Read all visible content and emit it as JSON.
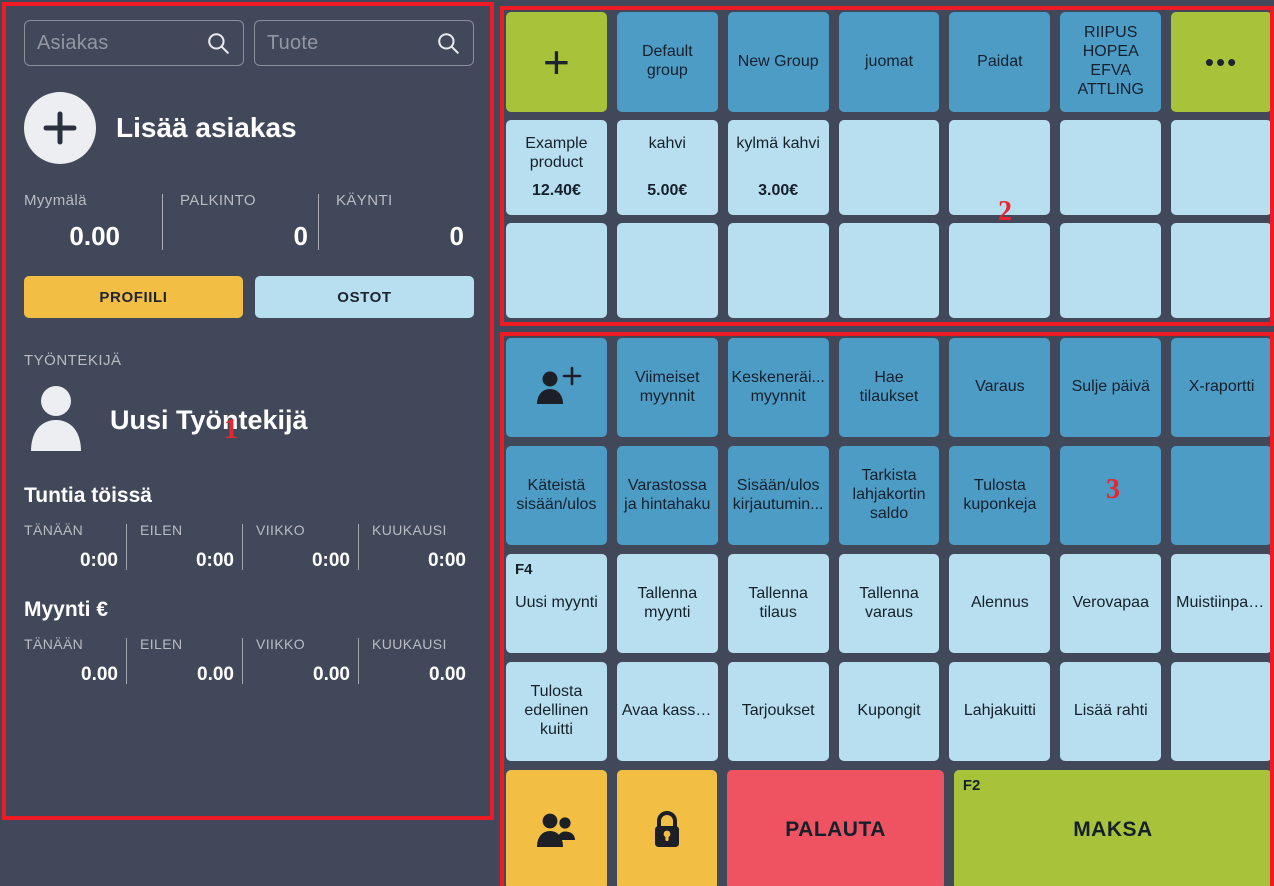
{
  "colors": {
    "background": "#414859",
    "green": "#a8c23a",
    "steel_blue": "#4c9cc6",
    "light_blue": "#b8dff0",
    "yellow": "#f2bf44",
    "red": "#ef5260",
    "annotation_red": "#ee1b24"
  },
  "annotations": [
    {
      "number": "1",
      "region": "customer-and-employee-panel"
    },
    {
      "number": "2",
      "region": "product-grid-panel"
    },
    {
      "number": "3",
      "region": "function-button-panel"
    }
  ],
  "left_panel": {
    "search": {
      "customer": {
        "placeholder": "Asiakas",
        "value": "",
        "icon": "search-icon"
      },
      "product": {
        "placeholder": "Tuote",
        "value": "",
        "icon": "search-icon"
      }
    },
    "customer": {
      "icon": "plus-circle-icon",
      "title": "Lisää asiakas",
      "stats": [
        {
          "label": "Myymälä",
          "value": "0.00"
        },
        {
          "label": "PALKINTO",
          "value": "0"
        },
        {
          "label": "KÄYNTI",
          "value": "0"
        }
      ],
      "buttons": [
        {
          "label": "PROFIILI",
          "color": "yellow"
        },
        {
          "label": "OSTOT",
          "color": "light_blue"
        }
      ]
    },
    "employee": {
      "section_label": "TYÖNTEKIJÄ",
      "icon": "user-avatar-icon",
      "name": "Uusi Työntekijä",
      "hours": {
        "title": "Tuntia töissä",
        "columns": [
          {
            "label": "TÄNÄÄN",
            "value": "0:00"
          },
          {
            "label": "EILEN",
            "value": "0:00"
          },
          {
            "label": "VIIKKO",
            "value": "0:00"
          },
          {
            "label": "KUUKAUSI",
            "value": "0:00"
          }
        ]
      },
      "sales": {
        "title": "Myynti €",
        "columns": [
          {
            "label": "TÄNÄÄN",
            "value": "0.00"
          },
          {
            "label": "EILEN",
            "value": "0.00"
          },
          {
            "label": "VIIKKO",
            "value": "0.00"
          },
          {
            "label": "KUUKAUSI",
            "value": "0.00"
          }
        ]
      }
    }
  },
  "product_panel": {
    "group_tabs": [
      {
        "label": "",
        "icon": "plus-icon",
        "color": "green"
      },
      {
        "label": "Default group",
        "color": "steel_blue"
      },
      {
        "label": "New Group",
        "color": "steel_blue"
      },
      {
        "label": "juomat",
        "color": "steel_blue"
      },
      {
        "label": "Paidat",
        "color": "steel_blue"
      },
      {
        "label": "RIIPUS HOPEA EFVA ATTLING",
        "color": "steel_blue"
      },
      {
        "label": "",
        "icon": "ellipsis-icon",
        "color": "green"
      }
    ],
    "products_row1": [
      {
        "name": "Example product",
        "price": "12.40€"
      },
      {
        "name": "kahvi",
        "price": "5.00€"
      },
      {
        "name": "kylmä kahvi",
        "price": "3.00€"
      },
      {
        "name": "",
        "price": ""
      },
      {
        "name": "",
        "price": ""
      },
      {
        "name": "",
        "price": ""
      },
      {
        "name": "",
        "price": ""
      }
    ],
    "products_row2": [
      {
        "name": "",
        "price": ""
      },
      {
        "name": "",
        "price": ""
      },
      {
        "name": "",
        "price": ""
      },
      {
        "name": "",
        "price": ""
      },
      {
        "name": "",
        "price": ""
      },
      {
        "name": "",
        "price": ""
      },
      {
        "name": "",
        "price": ""
      }
    ]
  },
  "function_panel": {
    "row1": [
      {
        "label": "",
        "icon": "add-person-icon",
        "color": "steel_blue"
      },
      {
        "label": "Viimeiset myynnit",
        "color": "steel_blue"
      },
      {
        "label": "Keskeneräi... myynnit",
        "color": "steel_blue"
      },
      {
        "label": "Hae tilaukset",
        "color": "steel_blue"
      },
      {
        "label": "Varaus",
        "color": "steel_blue"
      },
      {
        "label": "Sulje päivä",
        "color": "steel_blue"
      },
      {
        "label": "X-raportti",
        "color": "steel_blue"
      }
    ],
    "row2": [
      {
        "label": "Käteistä sisään/ulos",
        "color": "steel_blue"
      },
      {
        "label": "Varastossa ja hintahaku",
        "color": "steel_blue"
      },
      {
        "label": "Sisään/ulos kirjautumin...",
        "color": "steel_blue"
      },
      {
        "label": "Tarkista lahjakortin saldo",
        "color": "steel_blue"
      },
      {
        "label": "Tulosta kuponkeja",
        "color": "steel_blue"
      },
      {
        "label": "",
        "color": "steel_blue"
      },
      {
        "label": "",
        "color": "steel_blue"
      }
    ],
    "row3": [
      {
        "label": "Uusi myynti",
        "hotkey": "F4",
        "color": "light_blue"
      },
      {
        "label": "Tallenna myynti",
        "color": "light_blue"
      },
      {
        "label": "Tallenna tilaus",
        "color": "light_blue"
      },
      {
        "label": "Tallenna varaus",
        "color": "light_blue"
      },
      {
        "label": "Alennus",
        "color": "light_blue"
      },
      {
        "label": "Verovapaa",
        "color": "light_blue"
      },
      {
        "label": "Muistiinpan...",
        "color": "light_blue"
      }
    ],
    "row4": [
      {
        "label": "Tulosta edellinen kuitti",
        "color": "light_blue"
      },
      {
        "label": "Avaa kassalaatik...",
        "color": "light_blue"
      },
      {
        "label": "Tarjoukset",
        "color": "light_blue"
      },
      {
        "label": "Kupongit",
        "color": "light_blue"
      },
      {
        "label": "Lahjakuitti",
        "color": "light_blue"
      },
      {
        "label": "Lisää rahti",
        "color": "light_blue"
      },
      {
        "label": "",
        "color": "light_blue"
      }
    ],
    "actions": [
      {
        "label": "",
        "icon": "users-icon",
        "color": "yellow"
      },
      {
        "label": "",
        "icon": "lock-icon",
        "color": "yellow"
      },
      {
        "label": "PALAUTA",
        "color": "red"
      },
      {
        "label": "MAKSA",
        "hotkey": "F2",
        "color": "green"
      }
    ]
  }
}
